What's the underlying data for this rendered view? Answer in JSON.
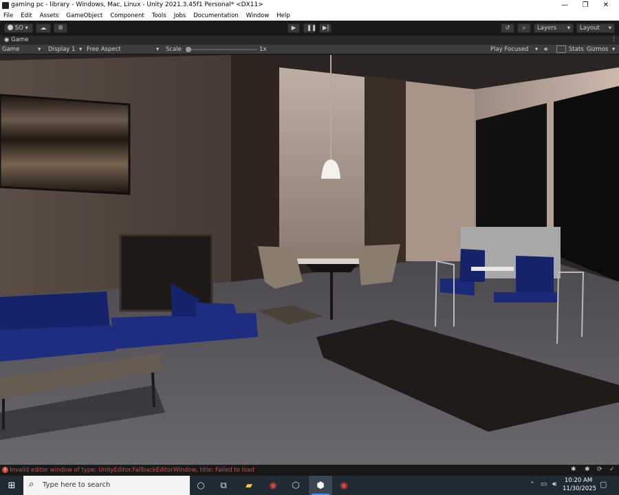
{
  "window": {
    "title": "gaming pc - library - Windows, Mac, Linux - Unity 2021.3.45f1 Personal* <DX11>",
    "minimize_glyph": "—",
    "restore_glyph": "❐",
    "close_glyph": "✕"
  },
  "menu": [
    "File",
    "Edit",
    "Assets",
    "GameObject",
    "Component",
    "Tools",
    "Jobs",
    "Documentation",
    "Window",
    "Help"
  ],
  "toolbar": {
    "account_label": "SO",
    "layers_label": "Layers",
    "layout_label": "Layout"
  },
  "game_tab": {
    "tab_label": "Game",
    "mode_label": "Game",
    "display_label": "Display 1",
    "aspect_label": "Free Aspect",
    "scale_label": "Scale",
    "scale_value": "1x",
    "scale_fraction": 0.0,
    "play_focus_label": "Play Focused",
    "stats_label": "Stats",
    "gizmos_label": "Gizmos"
  },
  "status": {
    "message": "Invalid editor window of type: UnityEditor.FallbackEditorWindow, title: Failed to load",
    "color": "#e04545"
  },
  "taskbar": {
    "search_placeholder": "Type here to search",
    "time": "10:20 AM",
    "date": "11/30/2025"
  },
  "colors": {
    "editor_bg": "#191919",
    "accent": "#4c8cf0"
  }
}
